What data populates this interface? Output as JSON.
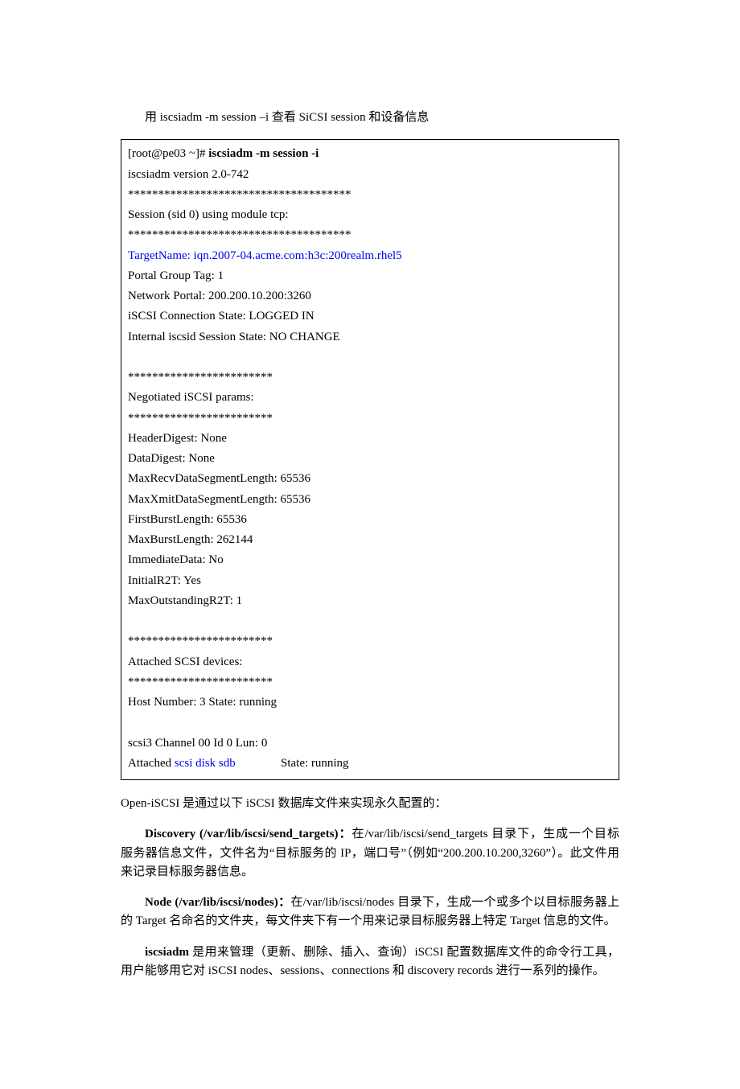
{
  "intro": "用 iscsiadm -m session –i 查看 SiCSI session 和设备信息",
  "cmd": {
    "prompt": "[root@pe03 ~]# ",
    "command": "iscsiadm -m session -i",
    "l1": "iscsiadm version 2.0-742",
    "sep37": "*************************************",
    "l2": "Session (sid 0) using module tcp:",
    "target": "TargetName: iqn.2007-04.acme.com:h3c:200realm.rhel5",
    "l3": "Portal Group Tag: 1",
    "l4": "Network Portal: 200.200.10.200:3260",
    "l5": "iSCSI Connection State: LOGGED IN",
    "l6": "Internal iscsid Session State: NO CHANGE",
    "sep24": "************************",
    "l7": "Negotiated iSCSI params:",
    "l8": "HeaderDigest: None",
    "l9": "DataDigest: None",
    "l10": "MaxRecvDataSegmentLength: 65536",
    "l11": "MaxXmitDataSegmentLength: 65536",
    "l12": "FirstBurstLength: 65536",
    "l13": "MaxBurstLength: 262144",
    "l14": "ImmediateData: No",
    "l15": "InitialR2T: Yes",
    "l16": "MaxOutstandingR2T: 1",
    "l17": "Attached SCSI devices:",
    "l18": "Host Number: 3    State: running",
    "l19": "scsi3 Channel 00 Id 0 Lun: 0",
    "l20a": "Attached ",
    "l20b": "scsi disk sdb",
    "l20c": "               State: running"
  },
  "body": {
    "p1": "Open-iSCSI 是通过以下 iSCSI 数据库文件来实现永久配置的：",
    "p2a": "Discovery (/var/lib/iscsi/send_targets)：",
    "p2b": "在/var/lib/iscsi/send_targets 目录下，生成一个目标服务器信息文件，文件名为“目标服务的 IP，端口号”（例如“200.200.10.200,3260”）。此文件用来记录目标服务器信息。",
    "p3a": "Node (/var/lib/iscsi/nodes)：",
    "p3b": "在/var/lib/iscsi/nodes 目录下，生成一个或多个以目标服务器上的 Target 名命名的文件夹，每文件夹下有一个用来记录目标服务器上特定 Target 信息的文件。",
    "p4a": "iscsiadm ",
    "p4b": "是用来管理（更新、删除、插入、查询）iSCSI 配置数据库文件的命令行工具，用户能够用它对 iSCSI nodes、sessions、connections 和 discovery records 进行一系列的操作。"
  }
}
